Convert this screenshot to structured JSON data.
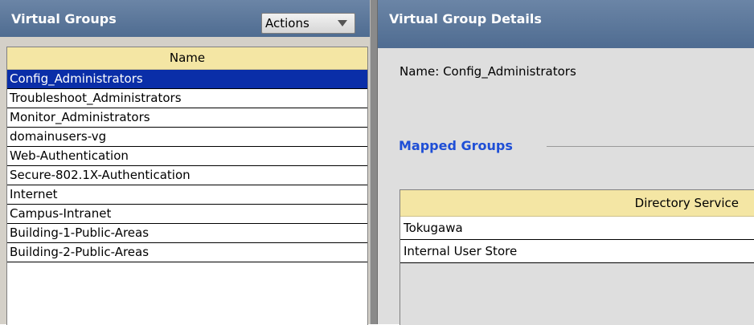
{
  "left_panel": {
    "title": "Virtual Groups",
    "actions_label": "Actions",
    "column_header": "Name",
    "groups": [
      {
        "name": "Config_Administrators",
        "selected": true
      },
      {
        "name": "Troubleshoot_Administrators",
        "selected": false
      },
      {
        "name": "Monitor_Administrators",
        "selected": false
      },
      {
        "name": "domainusers-vg",
        "selected": false
      },
      {
        "name": "Web-Authentication",
        "selected": false
      },
      {
        "name": "Secure-802.1X-Authentication",
        "selected": false
      },
      {
        "name": "Internet",
        "selected": false
      },
      {
        "name": "Campus-Intranet",
        "selected": false
      },
      {
        "name": "Building-1-Public-Areas",
        "selected": false
      },
      {
        "name": "Building-2-Public-Areas",
        "selected": false
      }
    ]
  },
  "right_panel": {
    "title": "Virtual Group Details",
    "name_line": "Name:  Config_Administrators",
    "mapped_groups_title": "Mapped Groups",
    "directory_header": "Directory Service",
    "directory_rows": [
      "Tokugawa",
      "Internal User Store"
    ]
  },
  "colors": {
    "header_bar": "#5a7598",
    "selection": "#0a2ea8",
    "column_header": "#f4e6a4",
    "section_title": "#1f4fd6"
  },
  "icons": {
    "actions_dropdown": "chevron-down-icon"
  }
}
